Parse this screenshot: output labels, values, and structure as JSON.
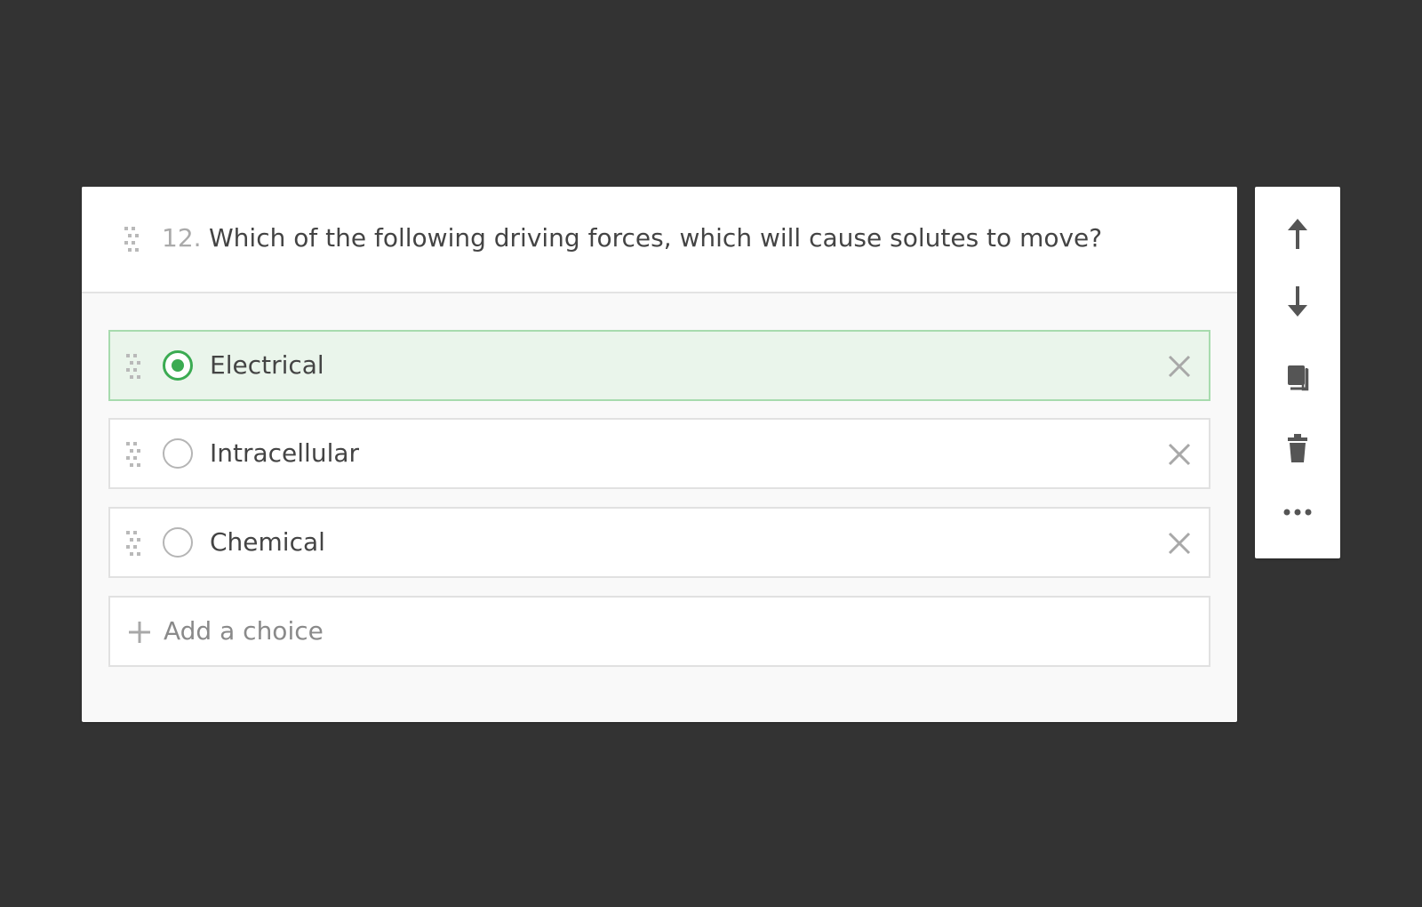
{
  "question": {
    "number": "12.",
    "text": "Which of the following driving forces, which will cause solutes to move?"
  },
  "choices": [
    {
      "label": "Electrical",
      "selected": true
    },
    {
      "label": "Intracellular",
      "selected": false
    },
    {
      "label": "Chemical",
      "selected": false
    }
  ],
  "add_choice": {
    "label": "Add a choice"
  },
  "toolbar": {
    "icons": [
      "arrow-up-icon",
      "arrow-down-icon",
      "duplicate-icon",
      "trash-icon",
      "more-icon"
    ]
  },
  "colors": {
    "background": "#333333",
    "accent_green": "#3bab52",
    "selected_fill": "#eaf5eb",
    "selected_border": "#a7dbae"
  }
}
